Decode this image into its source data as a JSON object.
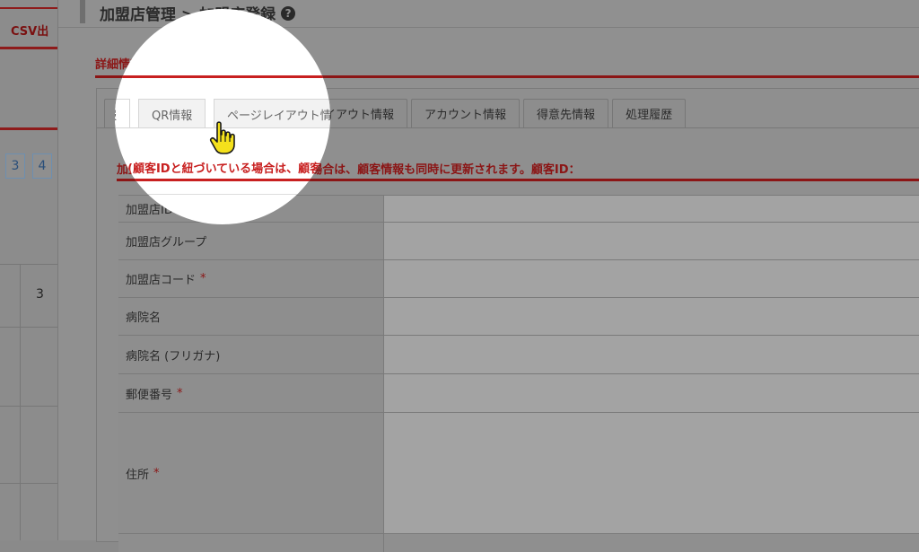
{
  "background": {
    "csv_label": "CSV出",
    "pagination": [
      "3",
      "4"
    ],
    "row_number": "3"
  },
  "modal": {
    "title": "加盟店管理 > 加盟店登録",
    "section_label": "詳細情報",
    "tabs": [
      {
        "label": "加盟店情報",
        "active": true
      },
      {
        "label": "QR情報",
        "active": false
      },
      {
        "label": "ページレイアウト情報",
        "active": false
      },
      {
        "label": "アカウント情報",
        "active": false
      },
      {
        "label": "得意先情報",
        "active": false
      },
      {
        "label": "処理履歴",
        "active": false
      }
    ],
    "info_heading": "加盟店情報　(顧客IDと紐づいている場合は、顧客情報も同時に更新されます。顧客ID：",
    "fields": [
      {
        "label": "加盟店ID",
        "required": "*"
      },
      {
        "label": "加盟店グループ",
        "required": ""
      },
      {
        "label": "加盟店コード",
        "required": "*"
      },
      {
        "label": "病院名",
        "required": ""
      },
      {
        "label": "病院名 (フリガナ)",
        "required": ""
      },
      {
        "label": "郵便番号",
        "required": "*"
      },
      {
        "label": "住所",
        "required": "*"
      }
    ]
  },
  "colors": {
    "accent_red": "#c82020",
    "dim_red": "#8b1515"
  },
  "icons": {
    "help": "question-circle-icon",
    "cursor": "hand-pointer-icon"
  }
}
